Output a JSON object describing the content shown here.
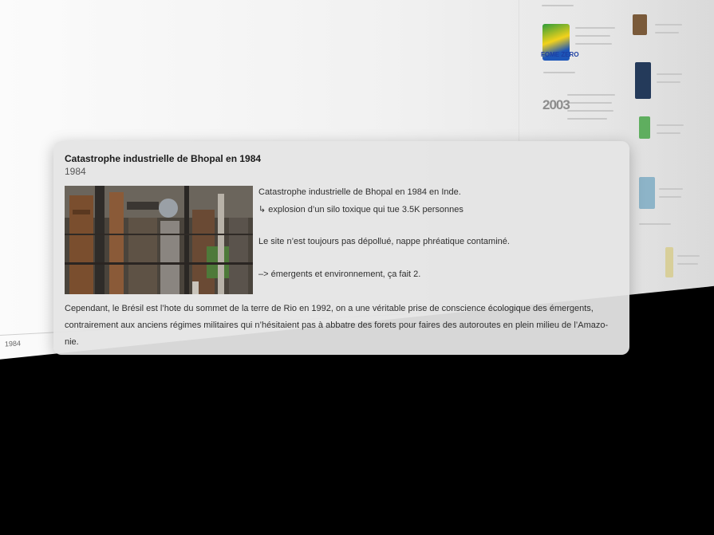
{
  "timeline": {
    "axis_year_label": "1984"
  },
  "side_column": {
    "logo_text": "FOME ZERO",
    "year_label": "2003"
  },
  "card": {
    "title": "Catastrophe industrielle de Bhopal en 1984",
    "year": "1984",
    "image_description": "photo of rusted abandoned chemical plant",
    "lines": [
      "Catastrophe industrielle de Bhopal en 1984 en Inde.",
      "↳ explosion d’un silo toxique qui tue 3.5K personnes",
      "Le site n’est toujours pas dépollué, nappe phréatique contaminé.",
      "–> émergents et environnement, ça fait 2."
    ],
    "body": "Cependant, le Brésil est l’hote du sommet de la terre de Rio en 1992, on a une véritable prise de conscience écologique des émergents, contrairement aux anciens régimes militaires qui n’hésitaient pas à abbatre des forets pour faires des autoroutes en plein milieu de l’Amazo-nie."
  },
  "colors": {
    "card_background": "#e4e4e4",
    "title_text": "#1a1a1a",
    "body_text": "#2e2e2e"
  }
}
